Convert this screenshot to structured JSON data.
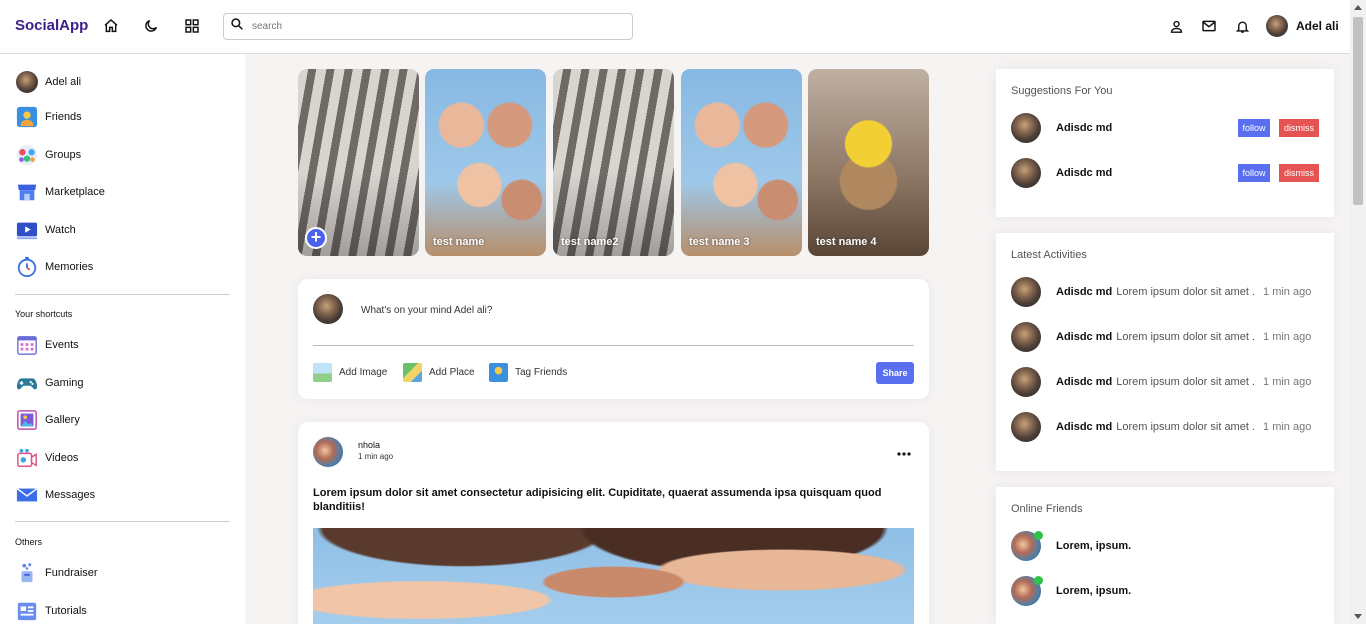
{
  "app": {
    "logo": "SocialApp"
  },
  "navbar": {
    "search_placeholder": "search",
    "user_name": "Adel ali"
  },
  "sidebar": {
    "main": [
      {
        "label": "Adel ali",
        "icon": "avatar"
      },
      {
        "label": "Friends",
        "icon": "friends-icon"
      },
      {
        "label": "Groups",
        "icon": "groups-icon"
      },
      {
        "label": "Marketplace",
        "icon": "marketplace-icon"
      },
      {
        "label": "Watch",
        "icon": "watch-icon"
      },
      {
        "label": "Memories",
        "icon": "memories-icon"
      }
    ],
    "shortcuts_title": "Your shortcuts",
    "shortcuts": [
      {
        "label": "Events",
        "icon": "events-icon"
      },
      {
        "label": "Gaming",
        "icon": "gaming-icon"
      },
      {
        "label": "Gallery",
        "icon": "gallery-icon"
      },
      {
        "label": "Videos",
        "icon": "videos-icon"
      },
      {
        "label": "Messages",
        "icon": "messages-icon"
      }
    ],
    "others_title": "Others",
    "others": [
      {
        "label": "Fundraiser",
        "icon": "fundraiser-icon"
      },
      {
        "label": "Tutorials",
        "icon": "tutorials-icon"
      }
    ]
  },
  "stories": [
    {
      "name": "",
      "add": true
    },
    {
      "name": "test name"
    },
    {
      "name": "test name2"
    },
    {
      "name": "test name 3"
    },
    {
      "name": "test name 4"
    }
  ],
  "share": {
    "placeholder": "What's on your mind Adel ali?",
    "add_image": "Add Image",
    "add_place": "Add Place",
    "tag_friends": "Tag Friends",
    "share_button": "Share"
  },
  "post": {
    "author": "nhola",
    "time": "1 min ago",
    "text": "Lorem ipsum dolor sit amet consectetur adipisicing elit. Cupiditate, quaerat assumenda ipsa quisquam quod blanditiis!"
  },
  "suggestions": {
    "title": "Suggestions For You",
    "items": [
      {
        "name": "Adisdc md",
        "follow": "follow",
        "dismiss": "dismiss"
      },
      {
        "name": "Adisdc md",
        "follow": "follow",
        "dismiss": "dismiss"
      }
    ]
  },
  "activities": {
    "title": "Latest Activities",
    "items": [
      {
        "name": "Adisdc md",
        "text": "Lorem ipsum dolor sit amet .",
        "time": "1 min ago"
      },
      {
        "name": "Adisdc md",
        "text": "Lorem ipsum dolor sit amet .",
        "time": "1 min ago"
      },
      {
        "name": "Adisdc md",
        "text": "Lorem ipsum dolor sit amet .",
        "time": "1 min ago"
      },
      {
        "name": "Adisdc md",
        "text": "Lorem ipsum dolor sit amet .",
        "time": "1 min ago"
      }
    ]
  },
  "online": {
    "title": "Online Friends",
    "items": [
      {
        "name": "Lorem, ipsum."
      },
      {
        "name": "Lorem, ipsum."
      }
    ]
  },
  "colors": {
    "brand": "#3b1e8a",
    "accent": "#5a6ff0",
    "dismiss": "#e55353",
    "online": "#2ec24a"
  }
}
